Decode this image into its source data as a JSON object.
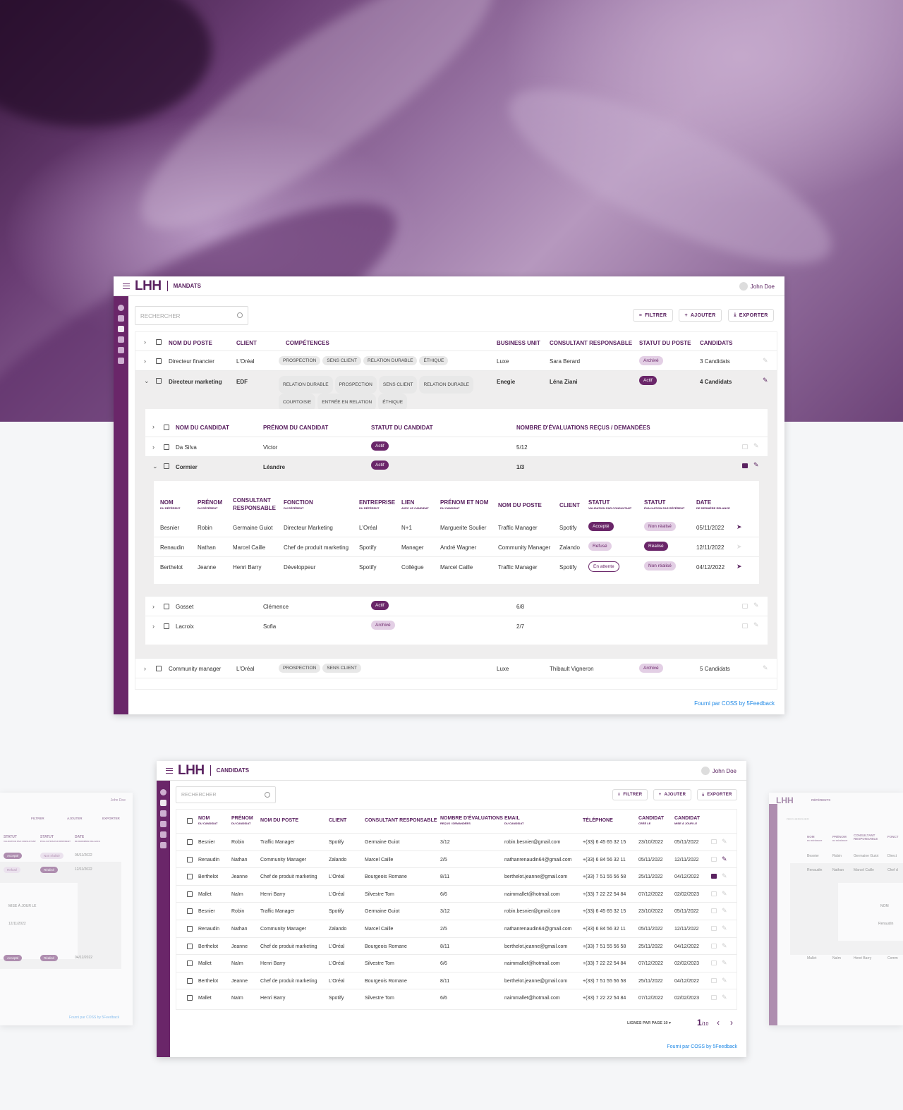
{
  "brand": {
    "logo": "LHH",
    "accent": "#6a2669"
  },
  "user": {
    "name": "John Doe"
  },
  "toolbar": {
    "search_placeholder": "RECHERCHER",
    "filter": "FILTRER",
    "add": "AJOUTER",
    "export": "EXPORTER"
  },
  "footer": "Fourni par COSS by 5Feedback",
  "mandats": {
    "crumb": "MANDATS",
    "headers": {
      "poste": "NOM DU POSTE",
      "client": "CLIENT",
      "competences": "COMPÉTENCES",
      "bu": "BUSINESS UNIT",
      "consultant": "CONSULTANT RESPONSABLE",
      "statut": "STATUT DU POSTE",
      "candidats": "CANDIDATS"
    },
    "rows": [
      {
        "poste": "Directeur financier",
        "client": "L'Oréal",
        "tags": [
          "PROSPECTION",
          "SENS CLIENT",
          "RELATION DURABLE",
          "ÉTHIQUE"
        ],
        "bu": "Luxe",
        "consultant": "Sara Berard",
        "statut": "Archivé",
        "candidats": "3 Candidats"
      },
      {
        "poste": "Directeur marketing",
        "client": "EDF",
        "tags": [
          "RELATION DURABLE",
          "PROSPECTION",
          "SENS CLIENT",
          "RELATION DURABLE",
          "COURTOISIE",
          "ENTRÉE EN RELATION",
          "ÉTHIQUE"
        ],
        "bu": "Enegie",
        "consultant": "Léna Ziani",
        "statut": "Actif",
        "candidats": "4 Candidats"
      },
      {
        "poste": "Community manager",
        "client": "L'Oréal",
        "tags": [
          "PROSPECTION",
          "SENS CLIENT"
        ],
        "bu": "Luxe",
        "consultant": "Thibault Vigneron",
        "statut": "Archivé",
        "candidats": "5 Candidats"
      }
    ],
    "cand_headers": {
      "nom": "NOM DU CANDIDAT",
      "prenom": "PRÉNOM DU CANDIDAT",
      "statut": "STATUT DU CANDIDAT",
      "evals": "NOMBRE D'ÉVALUATIONS REÇUS / DEMANDÉES"
    },
    "candidates": [
      {
        "nom": "Da Silva",
        "prenom": "Victor",
        "statut": "Actif",
        "evals": "5/12"
      },
      {
        "nom": "Cormier",
        "prenom": "Léandre",
        "statut": "Actif",
        "evals": "1/3"
      },
      {
        "nom": "Gosset",
        "prenom": "Clémence",
        "statut": "Actif",
        "evals": "6/8"
      },
      {
        "nom": "Lacroix",
        "prenom": "Sofia",
        "statut": "Archivé",
        "evals": "2/7"
      }
    ],
    "ref_headers": {
      "nom": "NOM",
      "nom_sub": "DU RÉFÉRENT",
      "prenom": "PRÉNOM",
      "prenom_sub": "DU RÉFÉRENT",
      "consultant": "CONSULTANT RESPONSABLE",
      "fonction": "FONCTION",
      "fonction_sub": "DU RÉFÉRENT",
      "entreprise": "ENTREPRISE",
      "entreprise_sub": "DU RÉFÉRENT",
      "lien": "LIEN",
      "lien_sub": "AVEC LE CANDIDAT",
      "prenom_nom": "PRÉNOM ET NOM",
      "prenom_nom_sub": "DU CANDIDAT",
      "poste": "NOM DU POSTE",
      "client": "CLIENT",
      "statut1": "STATUT",
      "statut1_sub": "VALIDATION PAR CONSULTANT",
      "statut2": "STATUT",
      "statut2_sub": "ÉVALUATION PAR RÉFÉRENT",
      "date": "DATE",
      "date_sub": "DE DERNIÈRE RELANCE"
    },
    "referents": [
      {
        "nom": "Besnier",
        "prenom": "Robin",
        "consultant": "Germaine Guiot",
        "fonction": "Directeur Marketing",
        "entreprise": "L'Oréal",
        "lien": "N+1",
        "candidat": "Marguerite Soulier",
        "poste": "Traffic Manager",
        "client": "Spotify",
        "statut1": "Accepté",
        "statut2": "Non réalisé",
        "date": "05/11/2022"
      },
      {
        "nom": "Renaudin",
        "prenom": "Nathan",
        "consultant": "Marcel Caille",
        "fonction": "Chef de produit marketing",
        "entreprise": "Spotify",
        "lien": "Manager",
        "candidat": "André Wagner",
        "poste": "Community Manager",
        "client": "Zalando",
        "statut1": "Refusé",
        "statut2": "Réalisé",
        "date": "12/11/2022"
      },
      {
        "nom": "Berthelot",
        "prenom": "Jeanne",
        "consultant": "Henri Barry",
        "fonction": "Développeur",
        "entreprise": "Spotify",
        "lien": "Collègue",
        "candidat": "Marcel Caille",
        "poste": "Traffic Manager",
        "client": "Spotify",
        "statut1": "En attente",
        "statut2": "Non réalisé",
        "date": "04/12/2022"
      }
    ]
  },
  "candidats": {
    "crumb": "CANDIDATS",
    "headers": {
      "nom": "NOM",
      "nom_sub": "DU CANDIDAT",
      "prenom": "PRÉNOM",
      "prenom_sub": "DU CANDIDAT",
      "poste": "NOM DU POSTE",
      "client": "CLIENT",
      "consultant": "CONSULTANT RESPONSABLE",
      "evals": "NOMBRE D'ÉVALUATIONS",
      "evals_sub": "REÇUS / DEMANDÉES",
      "email": "EMAIL",
      "email_sub": "DU CANDIDAT",
      "tel": "TÉLÉPHONE",
      "cree": "CANDIDAT",
      "cree_sub": "CRÉÉ LE",
      "maj": "CANDIDAT",
      "maj_sub": "MISE À JOUR LE"
    },
    "rows": [
      {
        "nom": "Besnier",
        "prenom": "Robin",
        "poste": "Traffic Manager",
        "client": "Spotify",
        "consultant": "Germaine Guiot",
        "evals": "3/12",
        "email": "robin.besnier@gmail.com",
        "tel": "+(33) 6 45 65 32 15",
        "cree": "23/10/2022",
        "maj": "05/11/2022"
      },
      {
        "nom": "Renaudin",
        "prenom": "Nathan",
        "poste": "Community Manager",
        "client": "Zalando",
        "consultant": "Marcel Caille",
        "evals": "2/5",
        "email": "nathanrenaudin64@gmail.com",
        "tel": "+(33) 6 84 56 32 11",
        "cree": "05/11/2022",
        "maj": "12/11/2022"
      },
      {
        "nom": "Berthelot",
        "prenom": "Jeanne",
        "poste": "Chef de produit marketing",
        "client": "L'Oréal",
        "consultant": "Bourgeois Romane",
        "evals": "8/11",
        "email": "berthelot.jeanne@gmail.com",
        "tel": "+(33) 7 51 55 56 58",
        "cree": "25/11/2022",
        "maj": "04/12/2022"
      },
      {
        "nom": "Mallet",
        "prenom": "Naïm",
        "poste": "Henri Barry",
        "client": "L'Oréal",
        "consultant": "Silvestre Tom",
        "evals": "6/6",
        "email": "naimmallet@hotmail.com",
        "tel": "+(33) 7 22 22 54 84",
        "cree": "07/12/2022",
        "maj": "02/02/2023"
      },
      {
        "nom": "Besnier",
        "prenom": "Robin",
        "poste": "Traffic Manager",
        "client": "Spotify",
        "consultant": "Germaine Guiot",
        "evals": "3/12",
        "email": "robin.besnier@gmail.com",
        "tel": "+(33) 6 45 65 32 15",
        "cree": "23/10/2022",
        "maj": "05/11/2022"
      },
      {
        "nom": "Renaudin",
        "prenom": "Nathan",
        "poste": "Community Manager",
        "client": "Zalando",
        "consultant": "Marcel Caille",
        "evals": "2/5",
        "email": "nathanrenaudin64@gmail.com",
        "tel": "+(33) 6 84 56 32 11",
        "cree": "05/11/2022",
        "maj": "12/11/2022"
      },
      {
        "nom": "Berthelot",
        "prenom": "Jeanne",
        "poste": "Chef de produit marketing",
        "client": "L'Oréal",
        "consultant": "Bourgeois Romane",
        "evals": "8/11",
        "email": "berthelot.jeanne@gmail.com",
        "tel": "+(33) 7 51 55 56 58",
        "cree": "25/11/2022",
        "maj": "04/12/2022"
      },
      {
        "nom": "Mallet",
        "prenom": "Naïm",
        "poste": "Henri Barry",
        "client": "L'Oréal",
        "consultant": "Silvestre Tom",
        "evals": "6/6",
        "email": "naimmallet@hotmail.com",
        "tel": "+(33) 7 22 22 54 84",
        "cree": "07/12/2022",
        "maj": "02/02/2023"
      },
      {
        "nom": "Berthelot",
        "prenom": "Jeanne",
        "poste": "Chef de produit marketing",
        "client": "L'Oréal",
        "consultant": "Bourgeois Romane",
        "evals": "8/11",
        "email": "berthelot.jeanne@gmail.com",
        "tel": "+(33) 7 51 55 56 58",
        "cree": "25/11/2022",
        "maj": "04/12/2022"
      },
      {
        "nom": "Mallet",
        "prenom": "Naïm",
        "poste": "Henri Barry",
        "client": "Spotify",
        "consultant": "Silvestre Tom",
        "evals": "6/6",
        "email": "naimmallet@hotmail.com",
        "tel": "+(33) 7 22 22 54 84",
        "cree": "07/12/2022",
        "maj": "02/02/2023"
      }
    ],
    "pagination": {
      "rows_label": "LIGNES PAR PAGE",
      "rows_value": "10",
      "page": "1",
      "total": "/10"
    }
  },
  "left_ghost": {
    "h1": "STATUT",
    "h1_sub": "VALIDATION PAR CONSULTANT",
    "h2": "STATUT",
    "h2_sub": "ÉVALUATION PAR RÉFÉRENT",
    "h3": "DATE",
    "h3_sub": "DE DERNIÈRE RELANCE",
    "r1": [
      "Accepté",
      "Non réalisé",
      "05/11/2022"
    ],
    "r2": [
      "Refusé",
      "Réalisé",
      "12/11/2022"
    ],
    "maj": "MISE À JOUR LE",
    "maj_date": "12/11/2022",
    "r3": [
      "Accepté",
      "Réalisé",
      "04/12/2022"
    ]
  },
  "right_ghost": {
    "crumb": "RÉFÉRENTS",
    "h1": "NOM",
    "h1_sub": "DU RÉFÉRENT",
    "h2": "PRÉNOM",
    "h2_sub": "DU RÉFÉRENT",
    "h3": "CONSULTANT RESPONSABLE",
    "h4": "FONCT",
    "r1": [
      "Besnier",
      "Robin",
      "Germaine Guiot",
      "Direct"
    ],
    "r2": [
      "Renaudin",
      "Nathan",
      "Marcel Caille",
      "Chef d"
    ],
    "inner_h": "NOM",
    "inner_v": "Renaudin",
    "r3": [
      "Mallet",
      "Naïm",
      "Henri Barry",
      "Comm"
    ]
  }
}
